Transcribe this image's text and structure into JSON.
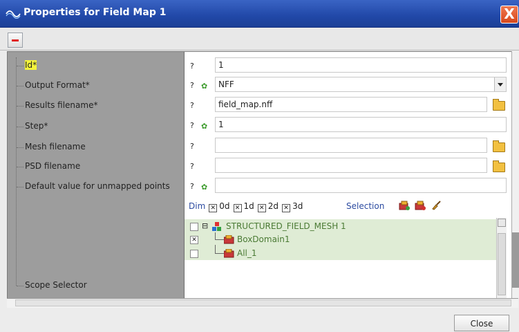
{
  "window": {
    "title": "Properties for Field Map 1",
    "close_glyph": "X"
  },
  "toolbar": {
    "remove_icon": "minus-icon"
  },
  "labels": [
    "Id*",
    "Output Format*",
    "Results filename*",
    "Step*",
    "Mesh filename",
    "PSD filename",
    "Default value for unmapped points",
    "Scope Selector"
  ],
  "help_mark": "?",
  "fields": {
    "id": "1",
    "output_format": "NFF",
    "results_filename": "field_map.nff",
    "step": "1",
    "mesh_filename": "",
    "psd_filename": "",
    "default_value": ""
  },
  "dim": {
    "label": "Dim",
    "options": [
      {
        "label": "0d",
        "checked": true
      },
      {
        "label": "1d",
        "checked": true
      },
      {
        "label": "2d",
        "checked": true
      },
      {
        "label": "3d",
        "checked": true
      }
    ]
  },
  "selection_label": "Selection",
  "tree": [
    {
      "label": "STRUCTURED_FIELD_MESH 1",
      "checked": false,
      "expand": "⊟"
    },
    {
      "label": "BoxDomain1",
      "checked": true
    },
    {
      "label": "All_1",
      "checked": false
    }
  ],
  "footer": {
    "close_label": "Close"
  },
  "colors": {
    "title_bar": "#2148a8",
    "label_pane": "#9d9d9d",
    "highlight": "#f4f43c",
    "tree_bg": "#dfecd5"
  }
}
